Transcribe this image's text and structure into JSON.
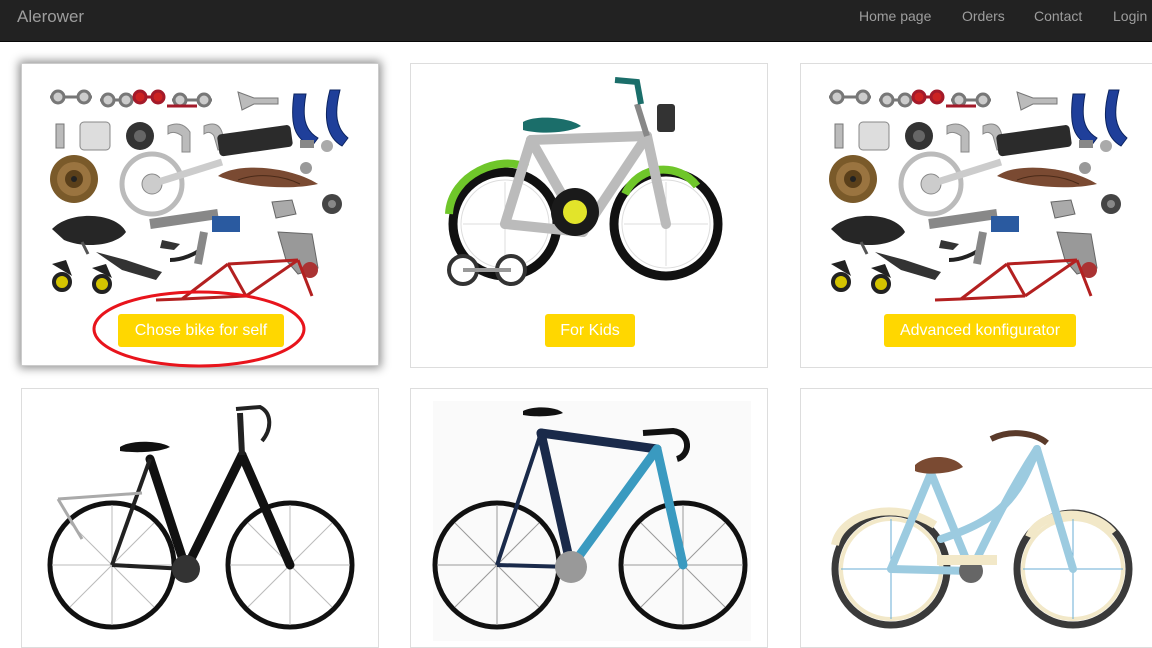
{
  "navbar": {
    "brand": "Alerower",
    "items": [
      "Home page",
      "Orders",
      "Contact",
      "Login"
    ]
  },
  "cards": [
    {
      "image": "bike-parts-image",
      "button": "Chose bike for self",
      "highlighted": true
    },
    {
      "image": "kids-bike-image",
      "button": "For Kids"
    },
    {
      "image": "bike-parts-image",
      "button": "Advanced konfigurator"
    },
    {
      "image": "trekking-bike-image"
    },
    {
      "image": "road-bike-image"
    },
    {
      "image": "cruiser-bike-image"
    }
  ],
  "colors": {
    "navbar_bg": "#222222",
    "nav_text": "#9d9d9d",
    "button_bg": "#ffd700",
    "button_text": "#ffffff",
    "highlight_ring": "#e8141c"
  }
}
